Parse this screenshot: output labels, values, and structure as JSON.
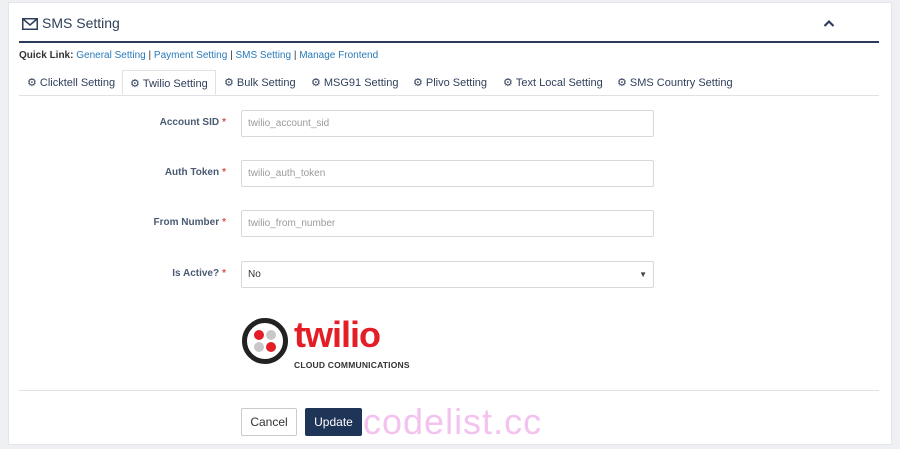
{
  "header": {
    "title": "SMS Setting"
  },
  "quick_links": {
    "label": "Quick Link:",
    "links": [
      "General Setting",
      "Payment Setting",
      "SMS Setting",
      "Manage Frontend"
    ],
    "separator": "|"
  },
  "tabs": [
    {
      "label": "Clicktell Setting",
      "active": false
    },
    {
      "label": "Twilio Setting",
      "active": true
    },
    {
      "label": "Bulk Setting",
      "active": false
    },
    {
      "label": "MSG91 Setting",
      "active": false
    },
    {
      "label": "Plivo Setting",
      "active": false
    },
    {
      "label": "Text Local Setting",
      "active": false
    },
    {
      "label": "SMS Country Setting",
      "active": false
    }
  ],
  "form": {
    "required_mark": "*",
    "account_sid": {
      "label": "Account SID",
      "placeholder": "twilio_account_sid",
      "value": ""
    },
    "auth_token": {
      "label": "Auth Token",
      "placeholder": "twilio_auth_token",
      "value": ""
    },
    "from_number": {
      "label": "From Number",
      "placeholder": "twilio_from_number",
      "value": ""
    },
    "is_active": {
      "label": "Is Active?",
      "selected": "No"
    }
  },
  "logo": {
    "brand": "twilio",
    "tagline": "CLOUD COMMUNICATIONS"
  },
  "buttons": {
    "cancel": "Cancel",
    "update": "Update"
  },
  "watermark": "codelist.cc",
  "colors": {
    "accent": "#1e3557",
    "link": "#2a7ab8",
    "required": "#d9534f",
    "twilio_red": "#e31e26"
  }
}
